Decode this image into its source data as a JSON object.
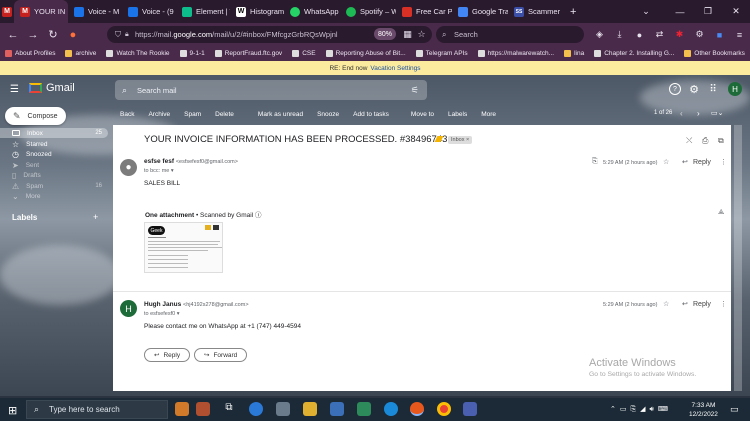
{
  "browser": {
    "tabs": [
      {
        "label": "YOUR IN",
        "color": "#c5221f",
        "icon": "gmail-icon",
        "active": true
      },
      {
        "label": "Voice - M",
        "color": "#1a73e8",
        "icon": "google-voice-icon"
      },
      {
        "label": "Voice - (9",
        "color": "#1a73e8",
        "icon": "google-voice-icon"
      },
      {
        "label": "Element | T",
        "color": "#0dbd8b",
        "icon": "element-icon"
      },
      {
        "label": "Histogram",
        "color": "#ffffff",
        "icon": "wikipedia-icon"
      },
      {
        "label": "WhatsApp",
        "color": "#25d366",
        "icon": "whatsapp-icon"
      },
      {
        "label": "Spotify – W",
        "color": "#1db954",
        "icon": "spotify-icon"
      },
      {
        "label": "Free Car P",
        "color": "#d93025",
        "icon": "car-icon"
      },
      {
        "label": "Google Tra",
        "color": "#4285f4",
        "icon": "google-translate-icon"
      },
      {
        "label": "Scammer",
        "color": "#3b4fa8",
        "icon": "scam-icon"
      }
    ],
    "url_prefix": "https://mail.",
    "url_domain": "google.com",
    "url_rest": "/mail/u/2/#inbox/FMfcgzGrbRQsWpjnl",
    "zoom": "80%",
    "search_placeholder": "Search",
    "bookmarks": [
      "About Profiles",
      "Watch The Rookie",
      "9-1-1",
      "ReportFraud.ftc.gov",
      "CSE",
      "Reporting Abuse of Bit...",
      "Telegram APIs",
      "https://malwarewatch...",
      "lina",
      "Chapter 2. Installing G...",
      "Other Bookmarks"
    ],
    "bookmark_first": "archive"
  },
  "notice": {
    "prefix": "RE: End now",
    "link": "Vacation Settings"
  },
  "gmail": {
    "logo_text": "Gmail",
    "search_placeholder": "Search mail",
    "avatar_letter": "H",
    "compose_label": "Compose",
    "sidebar": [
      {
        "label": "Inbox",
        "count": "25",
        "active": true
      },
      {
        "label": "Starred",
        "count": ""
      },
      {
        "label": "Snoozed",
        "count": ""
      },
      {
        "label": "Sent",
        "count": ""
      },
      {
        "label": "Drafts",
        "count": ""
      },
      {
        "label": "Spam",
        "count": "16"
      },
      {
        "label": "More",
        "count": ""
      }
    ],
    "labels_heading": "Labels",
    "toolbar": [
      "Back",
      "Archive",
      "Spam",
      "Delete",
      "Mark as unread",
      "Snooze",
      "Add to tasks",
      "Move to",
      "Labels",
      "More"
    ],
    "pager": "1 of 26",
    "subject": "YOUR INVOICE INFORMATION HAS BEEN PROCESSED. #38496743",
    "inbox_chip": "Inbox ×",
    "messages": [
      {
        "sender": "esfse fesf",
        "email": "<esfsefesf0@gmail.com>",
        "to": "to bcc: me",
        "time": "5:29 AM (2 hours ago)",
        "body": "SALES BILL",
        "avatar_color": "#6c6c6c",
        "avatar_letter": ""
      },
      {
        "sender": "Hugh Janus",
        "email": "<hj4192s278@gmail.com>",
        "to": "to esfsefesf0",
        "time": "5:29 AM (2 hours ago)",
        "body": "Please contact me on WhatsApp at +1 (747) 449-4594",
        "avatar_color": "#1e6b3a",
        "avatar_letter": "H"
      }
    ],
    "reply_label": "Reply",
    "attachment_count": "One attachment",
    "attachment_scan": "• Scanned by Gmail",
    "attachment_logo": "Geek",
    "reply_button": "Reply",
    "forward_button": "Forward"
  },
  "watermark": {
    "title": "Activate Windows",
    "sub": "Go to Settings to activate Windows."
  },
  "taskbar": {
    "search_placeholder": "Type here to search",
    "time": "7:33 AM",
    "date": "12/2/2022"
  }
}
